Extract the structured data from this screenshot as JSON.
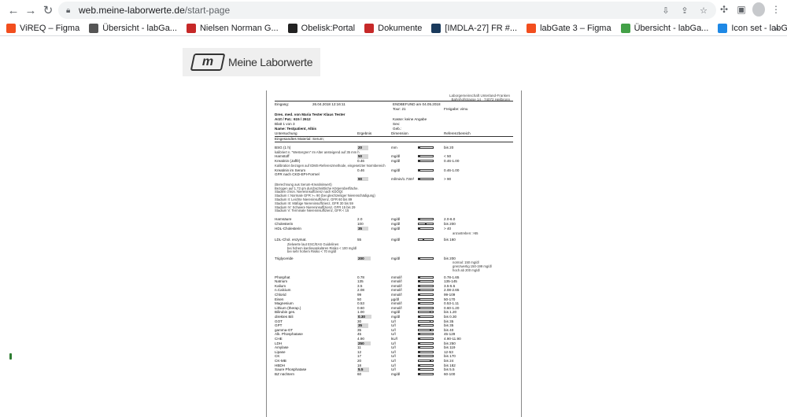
{
  "browser": {
    "url_host": "web.meine-laborwerte.de",
    "url_path": "/start-page",
    "bookmarks": [
      {
        "label": "ViREQ – Figma",
        "color": "#f24e1e"
      },
      {
        "label": "Übersicht - labGa...",
        "color": "#555555"
      },
      {
        "label": "Nielsen Norman G...",
        "color": "#c62828"
      },
      {
        "label": "Obelisk:Portal",
        "color": "#222222"
      },
      {
        "label": "Dokumente",
        "color": "#c62828"
      },
      {
        "label": "[IMDLA-27] FR #...",
        "color": "#1a3a5c"
      },
      {
        "label": "labGate 3 – Figma",
        "color": "#f24e1e"
      },
      {
        "label": "Übersicht - labGa...",
        "color": "#43a047"
      },
      {
        "label": "Icon set - labGate...",
        "color": "#1e88e5"
      }
    ],
    "more_label": "»"
  },
  "app": {
    "logo_text": "Meine Laborwerte",
    "logo_mark": "m"
  },
  "report": {
    "lab_header": [
      "Laborgemeinschaft Unterland-Franken",
      "Bahnhofstrasse 14 · 74072 Heilbronn"
    ],
    "eingang_label": "Eingang:",
    "eingang_value": "26.04.2018 12:16:11",
    "befund": "ENDBEFUND am 04.05.2018",
    "tour": "Tour:    21",
    "freigabe": "Freigabe: vimu",
    "doctor": "Dres. med. von Maria Tester Klaus Tester",
    "arzt_pat": "Arzt / Pat.:              615 / 2612",
    "blatt": "Blatt 1 von 3",
    "kasse": "Kasse:   keine Angabe",
    "sex": "Sex:",
    "name": "Name: Testpatient, Albis",
    "geb": "Geb.:",
    "col_headers": [
      "Untersuchung",
      "Ergebnis",
      "Dimension",
      "Referenzbereich"
    ],
    "material": "Eingesandtes Material: Serum;",
    "rows": [
      {
        "name": "BSG (1 h)",
        "value": "20",
        "unit": "mm",
        "ref": "bis 20",
        "box": true,
        "bar": [
          0.0,
          0.0
        ]
      },
      {
        "name": "kalibriert n. \"Westergren\"   Im Alter ansteigend auf 35 mm h",
        "value": "",
        "unit": "",
        "ref": "",
        "note": true
      },
      {
        "name": "Harnstoff",
        "value": "50",
        "unit": "mg/dl",
        "ref": "< 50",
        "box": true,
        "bar": [
          0.0,
          0.0
        ]
      },
      {
        "name": "Kreatinin (Jaffé)",
        "value": "0.46",
        "unit": "mg/dl",
        "ref": "0.46-1.00",
        "bar": [
          0.0,
          0.0
        ]
      },
      {
        "name": "Kalibration bezogen auf IDMS-Referenzmethode, eingesetzter Normbereich",
        "value": "",
        "unit": "",
        "ref": "",
        "note": true
      },
      {
        "name": "Kreatinin im Serum",
        "value": "0.46",
        "unit": "mg/dl",
        "ref": "0.46-1.00",
        "bar": [
          0.0,
          0.0
        ]
      },
      {
        "name": "GFR nach CKD-EPI-Formel",
        "value": "",
        "unit": "",
        "ref": ""
      },
      {
        "name": "",
        "value": "90",
        "unit": "ml/min/1.73m²",
        "ref": "> 90",
        "box": true,
        "bar": [
          0.0,
          0.0
        ]
      },
      {
        "name": "Harnsäure",
        "value": "2.0",
        "unit": "mg/dl",
        "ref": "2.0-6.0",
        "bar": [
          0.0,
          0.0
        ]
      },
      {
        "name": "Cholesterin",
        "value": "100",
        "unit": "mg/dl",
        "ref": "bis 200",
        "bar": [
          0.45,
          0.55
        ]
      },
      {
        "name": "HDL-Cholesterin",
        "value": "35",
        "unit": "mg/dl",
        "ref": "> 40",
        "box": true,
        "bar": [
          0.0,
          0.0
        ]
      },
      {
        "name": "LDL-Chol. enzymat.",
        "value": "55",
        "unit": "mg/dl",
        "ref": "bis 160",
        "bar": [
          0.3,
          0.4
        ]
      },
      {
        "name": "Triglyceride",
        "value": "200",
        "unit": "mg/dl",
        "ref": "bis 200",
        "box": true,
        "bar": [
          0.0,
          0.0
        ]
      },
      {
        "name": "Phosphat",
        "value": "0.78",
        "unit": "mmol/l",
        "ref": "0.78-1.65",
        "bar": [
          0.0,
          0.0
        ]
      },
      {
        "name": "Natrium",
        "value": "135",
        "unit": "mmol/l",
        "ref": "135-145",
        "bar": [
          0.0,
          0.0
        ]
      },
      {
        "name": "Kalium",
        "value": "3.5",
        "unit": "mmol/l",
        "ref": "3.5-5.5",
        "bar": [
          0.0,
          0.0
        ]
      },
      {
        "name": "n.Calcium",
        "value": "2.08",
        "unit": "mmol/l",
        "ref": "2.08-2.65",
        "bar": [
          0.0,
          0.0
        ]
      },
      {
        "name": "Chlorid",
        "value": "99",
        "unit": "mmol/l",
        "ref": "99-109",
        "bar": [
          0.0,
          0.0
        ]
      },
      {
        "name": "Eisen",
        "value": "50",
        "unit": "µg/dl",
        "ref": "50-170",
        "bar": [
          0.0,
          0.0
        ]
      },
      {
        "name": "Magnesium",
        "value": "0.53",
        "unit": "mmol/l",
        "ref": "0.53-1.11",
        "bar": [
          0.0,
          0.0
        ]
      },
      {
        "name": "Lithium (therap.)",
        "value": "0.60",
        "unit": "mmol/l",
        "ref": "0.60-1.20",
        "bar": [
          0.0,
          0.0
        ]
      },
      {
        "name": "Bilirubin ges.",
        "value": "1.00",
        "unit": "mg/dl",
        "ref": "bis 1.20",
        "bar": [
          0.75,
          0.85
        ]
      },
      {
        "name": "direktes Bili",
        "value": "0.30",
        "unit": "mg/dl",
        "ref": "bis 0.30",
        "box": true,
        "bar": [
          0.0,
          0.0
        ]
      },
      {
        "name": "GOT",
        "value": "30",
        "unit": "U/l",
        "ref": "bis 35",
        "bar": [
          0.75,
          0.85
        ]
      },
      {
        "name": "GPT",
        "value": "35",
        "unit": "U/l",
        "ref": "bis 35",
        "box": true,
        "bar": [
          0.0,
          0.0
        ]
      },
      {
        "name": "gamma-GT",
        "value": "35",
        "unit": "U/l",
        "ref": "bis 40",
        "bar": [
          0.8,
          0.9
        ]
      },
      {
        "name": "Alk. Phosphatase",
        "value": "45",
        "unit": "U/l",
        "ref": "45-129",
        "bar": [
          0.0,
          0.0
        ]
      },
      {
        "name": "CHE",
        "value": "4.90",
        "unit": "kU/l",
        "ref": "4.90-11.90",
        "bar": [
          0.0,
          0.0
        ]
      },
      {
        "name": "LDH",
        "value": "250",
        "unit": "U/l",
        "ref": "bis 250",
        "box": true,
        "bar": [
          0.0,
          0.0
        ]
      },
      {
        "name": "Amylase",
        "value": "11",
        "unit": "U/l",
        "ref": "bis 119",
        "bar": [
          0.0,
          0.0
        ]
      },
      {
        "name": "Lipase",
        "value": "12",
        "unit": "U/l",
        "ref": "12-53",
        "bar": [
          0.0,
          0.0
        ]
      },
      {
        "name": "CK",
        "value": "17",
        "unit": "U/l",
        "ref": "bis 170",
        "bar": [
          0.0,
          0.0
        ]
      },
      {
        "name": "CK-MB",
        "value": "20",
        "unit": "U/l",
        "ref": "bis 24",
        "bar": [
          0.8,
          0.9
        ]
      },
      {
        "name": "HBDH",
        "value": "18",
        "unit": "U/l",
        "ref": "bis 182",
        "bar": [
          0.0,
          0.0
        ]
      },
      {
        "name": "Saure Phosphatase",
        "value": "5.5",
        "unit": "U/l",
        "ref": "bis 5.5",
        "box": true,
        "bar": [
          0.0,
          0.0
        ]
      },
      {
        "name": "BZ nüchtern",
        "value": "60",
        "unit": "mg/dl",
        "ref": "60-100",
        "bar": [
          0.0,
          0.0
        ]
      }
    ],
    "notes_gfr": [
      "(Berechnung aus Serum-Kreatininwert)",
      "Bezogen auf 1,73 qm durchschnittliche Körperoberfläche.",
      "Stadien chron. Niereninsuffizienz nach KDOQI:",
      "Stadium I: Normale GFR >= 90 (bei gleichzeitiger Nierenschädigung)",
      "Stadium II: Leichte Niereninsuffizienz, GFR 60 bis 89",
      "Stadium III: Mäßige Niereninsuffizienz, GFR 30 bis 59",
      "Stadium IV: Schwere Niereninsuffizienz, GFR 15 bis 29",
      "Stadium V: Terminale Niereninsuffizienz, GFR < 15"
    ],
    "notes_ldl": [
      "Zielwerte laut ESC/EAS Guidelines",
      "bei hohem kardiovaskulären Risiko < 100 mg/dl",
      "bei sehr hohem Risiko < 70 mg/dl"
    ],
    "notes_hdl": [
      "anzustreben: >55"
    ],
    "notes_tg": [
      "normal: 150 mg/dl",
      "grenzwertig 150-199 mg/dl",
      "hoch ab 200 mg/dl"
    ]
  }
}
